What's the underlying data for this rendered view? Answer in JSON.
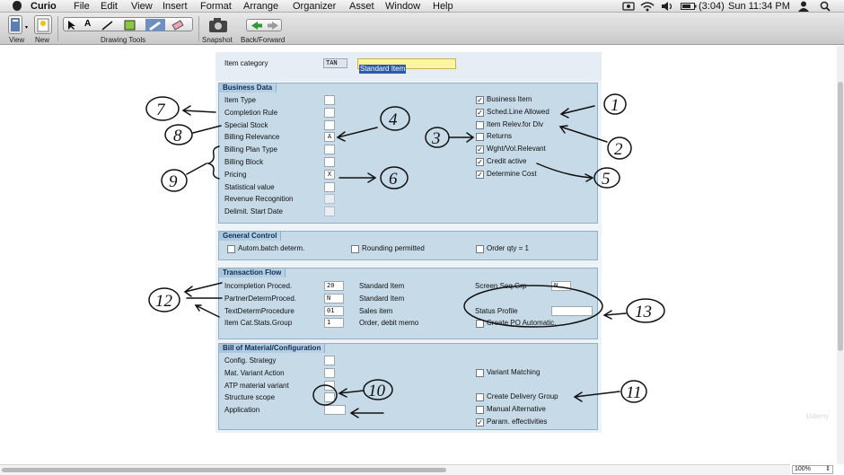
{
  "menubar": {
    "items": [
      "Curio",
      "File",
      "Edit",
      "View",
      "Insert",
      "Format",
      "Arrange",
      "Organizer",
      "Asset",
      "Window",
      "Help"
    ],
    "battery": "(3:04)",
    "clock": "Sun 11:34 PM"
  },
  "toolbar": {
    "view": "View",
    "new": "New",
    "drawing_tools": "Drawing Tools",
    "snapshot": "Snapshot",
    "back_forward": "Back/Forward"
  },
  "form": {
    "item_category_label": "Item category",
    "item_category_code": "TAN",
    "item_category_name": "Standard Item",
    "business_data": {
      "title": "Business Data",
      "left_rows": [
        {
          "label": "Item Type",
          "value": ""
        },
        {
          "label": "Completion Rule",
          "value": ""
        },
        {
          "label": "Special Stock",
          "value": ""
        },
        {
          "label": "Billing Relevance",
          "value": "A"
        },
        {
          "label": "Billing Plan Type",
          "value": ""
        },
        {
          "label": "Billing Block",
          "value": ""
        },
        {
          "label": "Pricing",
          "value": "X"
        },
        {
          "label": "Statistical value",
          "value": ""
        },
        {
          "label": "Revenue Recognition",
          "value": ""
        },
        {
          "label": "Delimit. Start Date",
          "value": ""
        }
      ],
      "right_checks": [
        {
          "label": "Business Item",
          "checked": true
        },
        {
          "label": "Sched.Line Allowed",
          "checked": true
        },
        {
          "label": "Item Relev.for Dlv",
          "checked": false
        },
        {
          "label": "Returns",
          "checked": false
        },
        {
          "label": "Wght/Vol.Relevant",
          "checked": true
        },
        {
          "label": "Credit active",
          "checked": true
        },
        {
          "label": "Determine Cost",
          "checked": true
        }
      ]
    },
    "general_control": {
      "title": "General Control",
      "checks": [
        {
          "label": "Autom.batch determ.",
          "checked": false
        },
        {
          "label": "Rounding permitted",
          "checked": false
        },
        {
          "label": "Order qty = 1",
          "checked": false
        }
      ]
    },
    "transaction_flow": {
      "title": "Transaction Flow",
      "rows": [
        {
          "label": "Incompletion Proced.",
          "value": "20",
          "desc": "Standard Item"
        },
        {
          "label": "PartnerDetermProced.",
          "value": "N",
          "desc": "Standard Item"
        },
        {
          "label": "TextDetermProcedure",
          "value": "01",
          "desc": "Sales item"
        },
        {
          "label": "Item Cat.Stats.Group",
          "value": "1",
          "desc": "Order, debit memo"
        }
      ],
      "screen_seq_label": "Screen Seq.Grp",
      "screen_seq_value": "N",
      "status_profile_label": "Status Profile",
      "status_profile_value": "",
      "create_po_label": "Create PO Automatic."
    },
    "bom": {
      "title": "Bill of Material/Configuration",
      "left_rows": [
        {
          "label": "Config. Strategy"
        },
        {
          "label": "Mat. Variant Action"
        },
        {
          "label": "ATP material variant"
        },
        {
          "label": "Structure scope"
        },
        {
          "label": "Application"
        }
      ],
      "right_checks": [
        {
          "label": "Variant Matching",
          "checked": false
        },
        {
          "label": "Create Delivery Group",
          "checked": false
        },
        {
          "label": "Manual Alternative",
          "checked": false
        },
        {
          "label": "Param. effectivities",
          "checked": true
        }
      ]
    }
  },
  "annotations": [
    "7",
    "8",
    "9",
    "4",
    "6",
    "1",
    "2",
    "3",
    "5",
    "12",
    "13",
    "10",
    "11"
  ],
  "statusbar": {
    "zoom": "100%"
  },
  "watermark": "Udemy",
  "colors": {
    "panel": "#c6dae8",
    "panel_title": "#0d2f57",
    "highlight": "#fff4a0",
    "selection": "#2a5aa8"
  }
}
